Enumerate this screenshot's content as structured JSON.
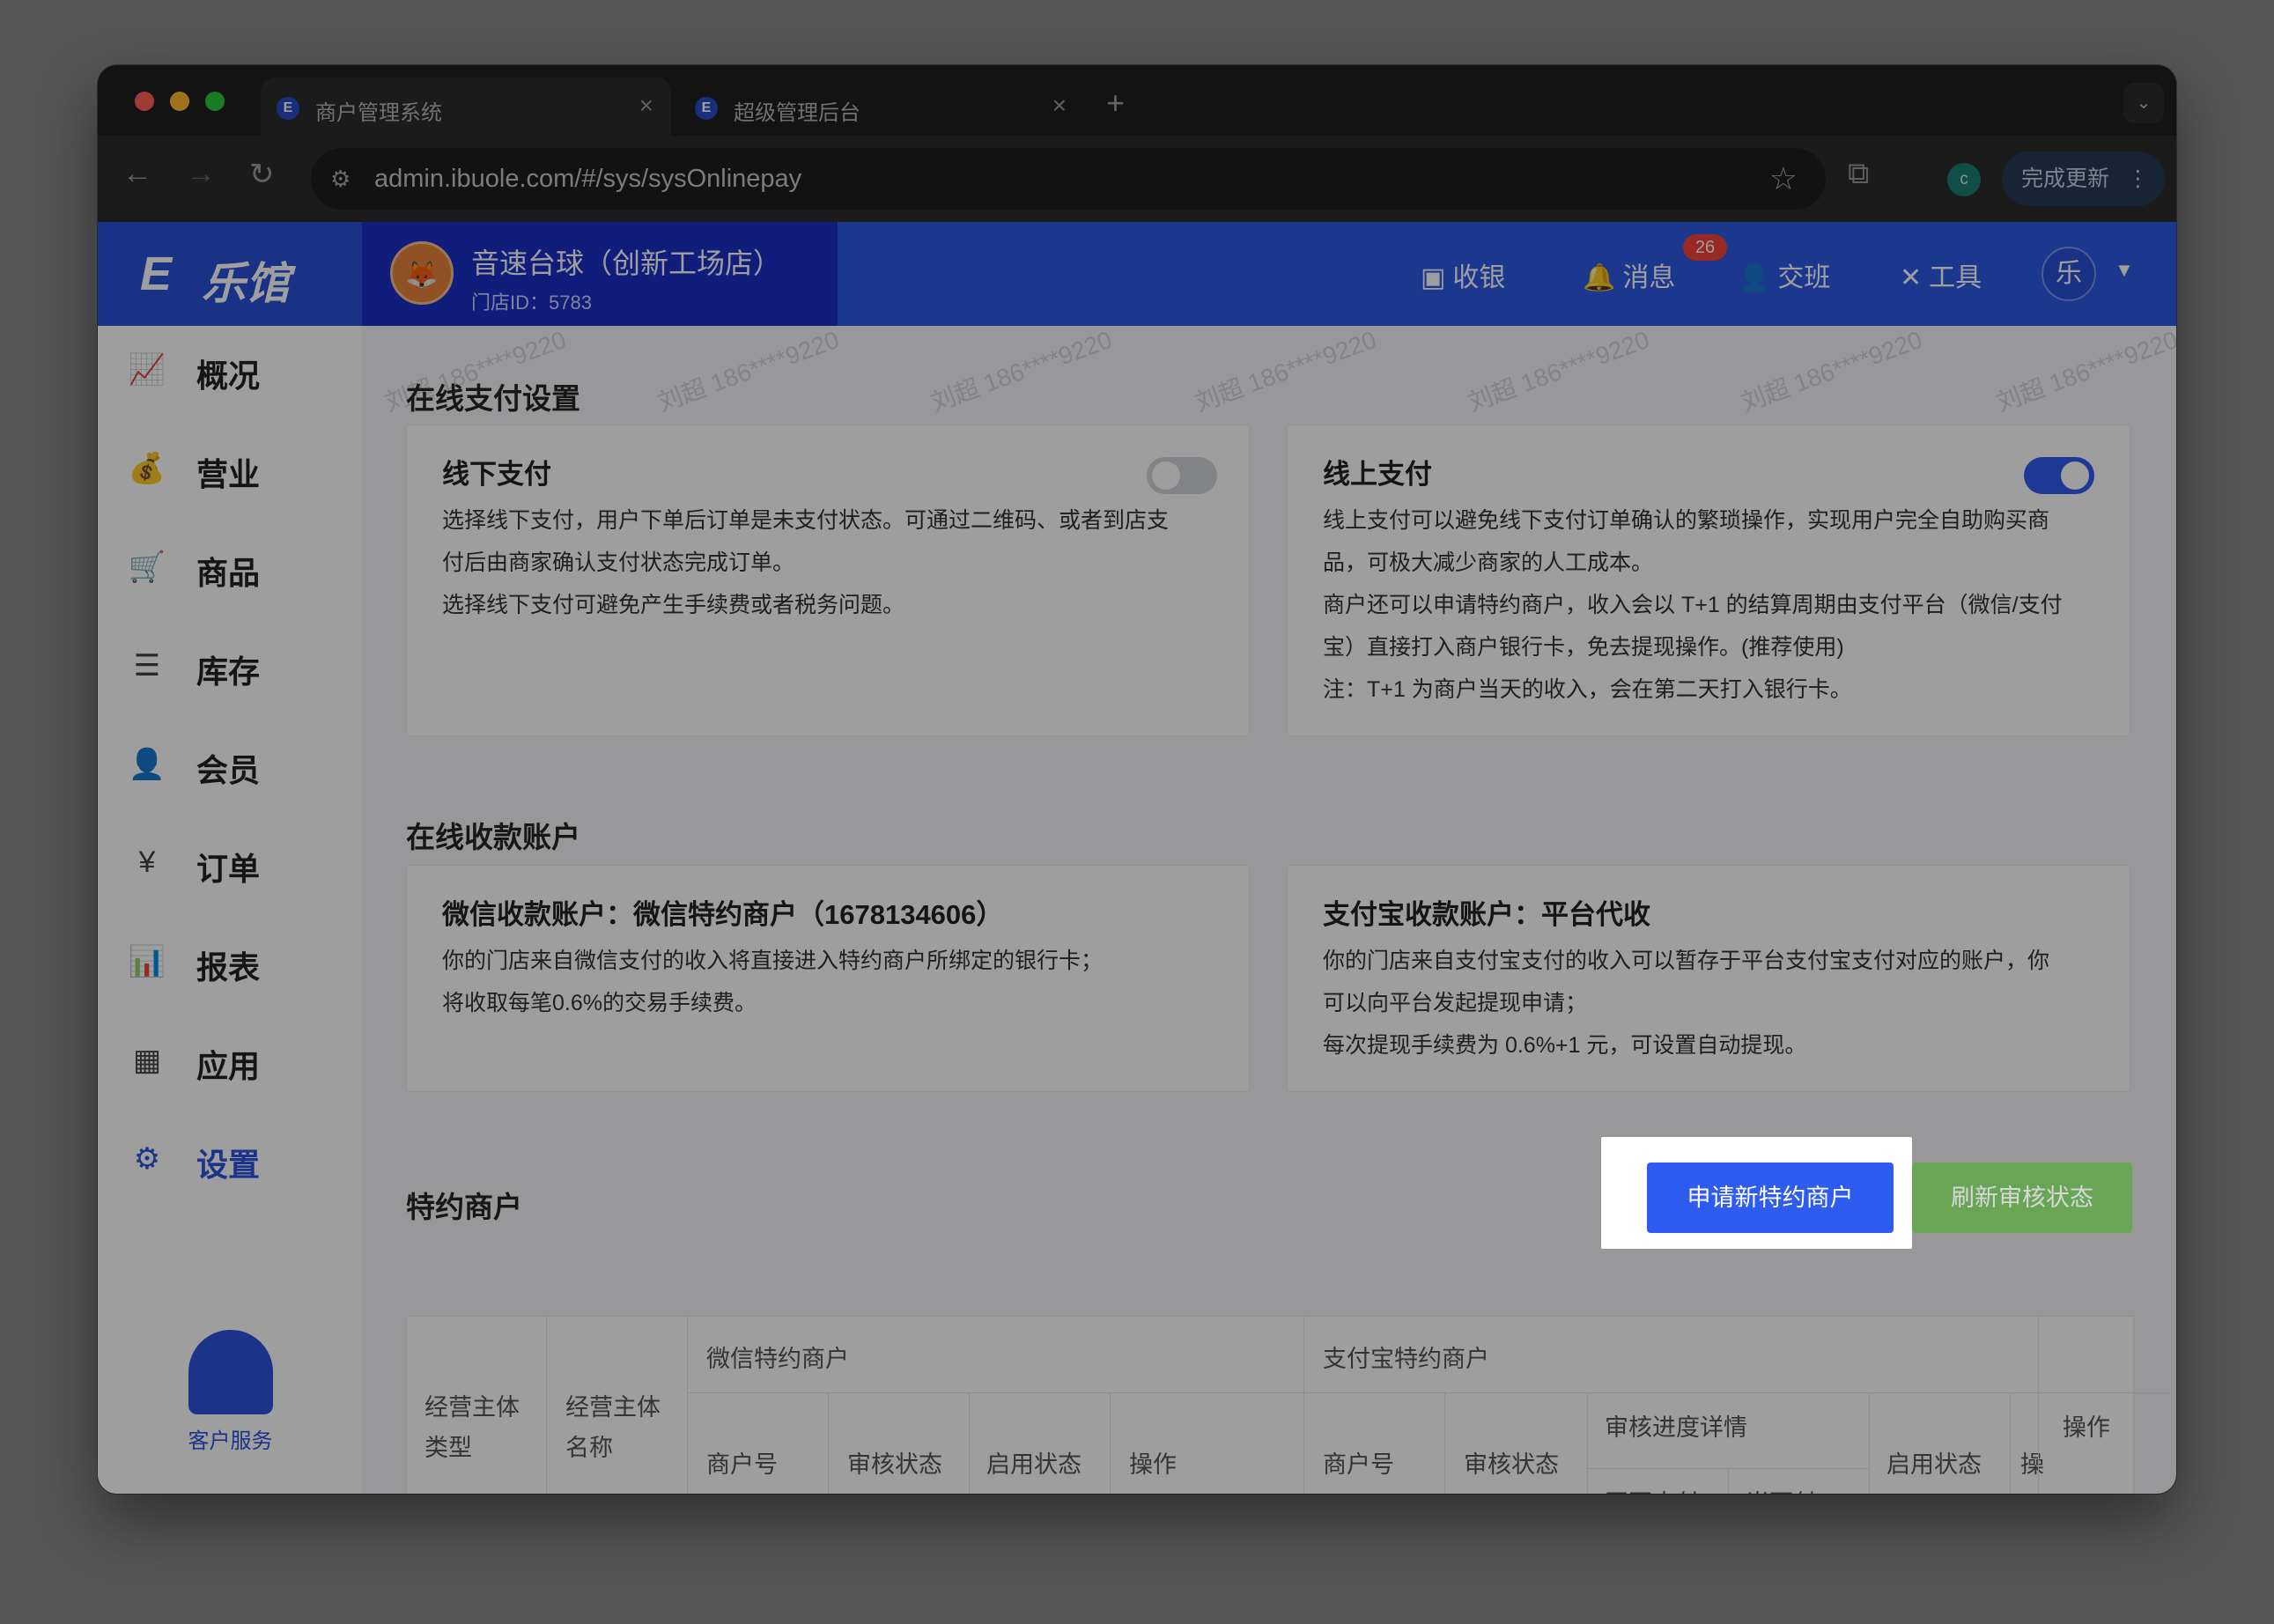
{
  "browser": {
    "tabs": [
      {
        "title": "商户管理系统",
        "active": true
      },
      {
        "title": "超级管理后台",
        "active": false
      }
    ],
    "url": "admin.ibuole.com/#/sys/sysOnlinepay",
    "profile_initial": "c",
    "update_button": "完成更新"
  },
  "header": {
    "brand": "乐馆",
    "store_name": "音速台球（创新工场店）",
    "store_id": "门店ID：5783",
    "nav": {
      "cashier": "收银",
      "messages": "消息",
      "message_count": "26",
      "handover": "交班",
      "tools": "工具"
    },
    "user_initial": "乐"
  },
  "sidebar": {
    "items": [
      {
        "label": "概况",
        "icon": "chart-icon"
      },
      {
        "label": "营业",
        "icon": "money-bag-icon"
      },
      {
        "label": "商品",
        "icon": "cart-icon"
      },
      {
        "label": "库存",
        "icon": "layers-icon"
      },
      {
        "label": "会员",
        "icon": "user-icon"
      },
      {
        "label": "订单",
        "icon": "receipt-icon"
      },
      {
        "label": "报表",
        "icon": "bar-chart-icon"
      },
      {
        "label": "应用",
        "icon": "apps-icon"
      },
      {
        "label": "设置",
        "icon": "gear-icon",
        "active": true
      }
    ],
    "service": "客户服务"
  },
  "online_payment": {
    "title": "在线支付设置",
    "offline": {
      "title": "线下支付",
      "enabled": false,
      "lines": [
        "选择线下支付，用户下单后订单是未支付状态。可通过二维码、或者到店支",
        "付后由商家确认支付状态完成订单。",
        "选择线下支付可避免产生手续费或者税务问题。"
      ]
    },
    "online": {
      "title": "线上支付",
      "enabled": true,
      "lines": [
        "线上支付可以避免线下支付订单确认的繁琐操作，实现用户完全自助购买商",
        "品，可极大减少商家的人工成本。",
        "商户还可以申请特约商户，收入会以 T+1 的结算周期由支付平台（微信/支付",
        "宝）直接打入商户银行卡，免去提现操作。(推荐使用)",
        "注：T+1 为商户当天的收入，会在第二天打入银行卡。"
      ]
    }
  },
  "accounts": {
    "title": "在线收款账户",
    "wechat": {
      "title": "微信收款账户：微信特约商户（1678134606）",
      "lines": [
        "你的门店来自微信支付的收入将直接进入特约商户所绑定的银行卡；",
        "将收取每笔0.6%的交易手续费。"
      ]
    },
    "alipay": {
      "title": "支付宝收款账户：平台代收",
      "lines": [
        "你的门店来自支付宝支付的收入可以暂存于平台支付宝支付对应的账户，你",
        "可以向平台发起提现申请；",
        "每次提现手续费为 0.6%+1 元，可设置自动提现。"
      ]
    }
  },
  "merchants": {
    "title": "特约商户",
    "apply_button": "申请新特约商户",
    "refresh_button": "刷新审核状态",
    "table": {
      "col_entity_type": "经营主体类型",
      "col_entity_type_l1": "经营主体",
      "col_entity_type_l2": "类型",
      "col_entity_name_l1": "经营主体",
      "col_entity_name_l2": "名称",
      "wechat_group": "微信特约商户",
      "alipay_group": "支付宝特约商户",
      "merchant_no": "商户号",
      "review_status": "审核状态",
      "enable_status": "启用状态",
      "action": "操作",
      "review_detail": "审核进度详情",
      "web_pay": "网页支付",
      "face_pay": "当面付",
      "col_truncated": "操",
      "actions": "操作"
    }
  },
  "watermark": "刘超 186****9220",
  "colors": {
    "brand_blue": "#2e59e6",
    "store_blue": "#1b2fc6",
    "primary_button": "#2f5cf0",
    "success_button": "#4caf2e",
    "active_nav": "#2d53de"
  }
}
